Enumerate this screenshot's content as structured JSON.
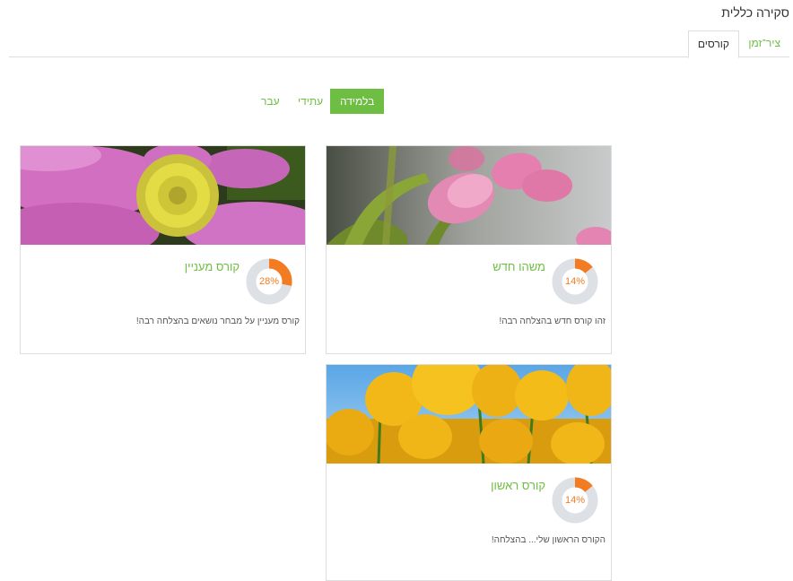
{
  "page": {
    "title": "סקירה כללית"
  },
  "tabs": [
    {
      "label": "ציר־זמן",
      "active": false
    },
    {
      "label": "קורסים",
      "active": true
    }
  ],
  "filters": [
    {
      "label": "בלמידה",
      "active": true
    },
    {
      "label": "עתידי",
      "active": false
    },
    {
      "label": "עבר",
      "active": false
    }
  ],
  "courses": [
    {
      "name": "משהו חדש",
      "progress_text": "14%",
      "progress": 14,
      "description": "זהו קורס חדש  בהצלחה רבה!",
      "image_icon": "pink-tulips-image"
    },
    {
      "name": "קורס מעניין",
      "progress_text": "28%",
      "progress": 28,
      "description": "קורס מעניין על מבחר נושאים בהצלחה רבה!",
      "image_icon": "pink-cosmos-flower-image"
    },
    {
      "name": "קורס ראשון",
      "progress_text": "14%",
      "progress": 14,
      "description": "הקורס הראשון שלי... בהצלחה!",
      "image_icon": "yellow-tulips-image"
    }
  ],
  "colors": {
    "accent": "#6fbe44",
    "progress": "#f37b22",
    "track": "#dde1e6"
  }
}
